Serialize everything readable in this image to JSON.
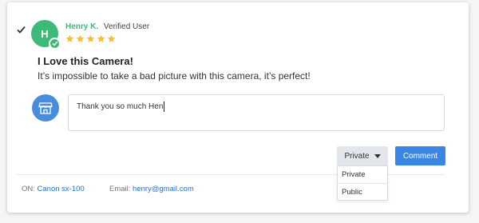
{
  "review": {
    "author_initial": "H",
    "author_name": "Henry K.",
    "author_status": "Verified User",
    "rating": 5,
    "title": "I Love this Camera!",
    "body": "It’s impossible to take a bad picture with this camera, it’s perfect!"
  },
  "reply": {
    "text": "Thank you so much Hen"
  },
  "actions": {
    "privacy_selected": "Private",
    "privacy_options": [
      "Private",
      "Public"
    ],
    "comment_label": "Comment"
  },
  "meta": {
    "product_label": "ON:",
    "product_value": "Canon sx-100",
    "email_label": "Email:",
    "email_value": "henry@gmail.com"
  },
  "colors": {
    "author_green": "#3db978",
    "star_yellow": "#f7c12a",
    "accent_blue": "#3b86e4",
    "link_blue": "#2a6fc9"
  },
  "icons": {
    "select": "checkmark-icon",
    "verified": "verified-check-icon",
    "star": "star-icon",
    "store": "storefront-icon",
    "dropdown": "caret-down-icon"
  }
}
